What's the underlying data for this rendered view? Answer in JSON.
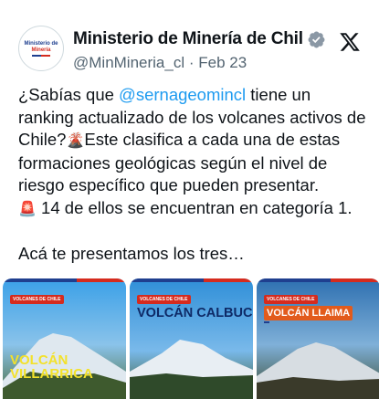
{
  "author": {
    "display_name": "Ministerio de Minería de Chil",
    "handle": "@MinMineria_cl",
    "separator": "·",
    "date": "Feb 23",
    "avatar_logo_line1": "Ministerio de",
    "avatar_logo_line2": "Minería",
    "verified_icon": "verified-badge-icon",
    "verified_color": "#8b98a5"
  },
  "platform_icon": "x-logo-icon",
  "tweet": {
    "part1": "¿Sabías que ",
    "mention": "@sernageomincl",
    "part2": " tiene un ranking actualizado de los volcanes activos de Chile?",
    "volcano_emoji": "🌋",
    "part3": "Este clasifica a cada una de estas formaciones geológicas según el nivel de riesgo específico que pueden presentar.",
    "alert_emoji": "🚨",
    "part4": " 14 de ellos se encuentran en categoría 1.",
    "part5": "Acá te presentamos los tres…",
    "mention_color": "#1d9bf0"
  },
  "media": [
    {
      "tag": "VOLCANES DE CHILE",
      "title_line1": "VOLCÁN",
      "title_line2": "VILLARRICA"
    },
    {
      "tag": "VOLCANES DE CHILE",
      "title": "VOLCÁN CALBUCO"
    },
    {
      "tag": "VOLCANES DE CHILE",
      "title": "VOLCÁN LLAIMA"
    }
  ]
}
